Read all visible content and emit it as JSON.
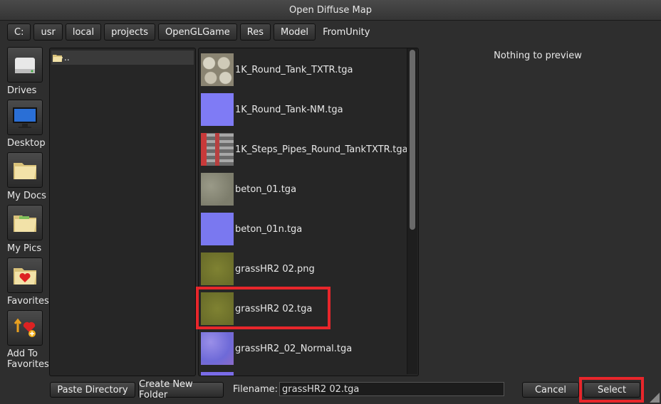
{
  "window": {
    "title": "Open Diffuse Map"
  },
  "breadcrumbs": [
    "C:",
    "usr",
    "local",
    "projects",
    "OpenGLGame",
    "Res",
    "Model",
    "FromUnity"
  ],
  "sidebar": {
    "items": [
      {
        "label": "Drives",
        "icon": "drive-icon"
      },
      {
        "label": "Desktop",
        "icon": "monitor-icon"
      },
      {
        "label": "My Docs",
        "icon": "folder-icon"
      },
      {
        "label": "My Pics",
        "icon": "picture-folder-icon"
      },
      {
        "label": "Favorites",
        "icon": "heart-folder-icon"
      },
      {
        "label": "Add To\nFavorites",
        "icon": "add-favorite-icon"
      }
    ]
  },
  "directories": {
    "items": [
      {
        "label": ".."
      }
    ]
  },
  "files": {
    "items": [
      {
        "name": "1K_Round_Tank_TXTR.tga",
        "thumb": "tank"
      },
      {
        "name": "1K_Round_Tank-NM.tga",
        "thumb": "normal"
      },
      {
        "name": "1K_Steps_Pipes_Round_TankTXTR.tga",
        "thumb": "pipes"
      },
      {
        "name": "beton_01.tga",
        "thumb": "concrete"
      },
      {
        "name": "beton_01n.tga",
        "thumb": "normal"
      },
      {
        "name": "grassHR2 02.png",
        "thumb": "grass"
      },
      {
        "name": "grassHR2 02.tga",
        "thumb": "grass"
      },
      {
        "name": "grassHR2_02_Normal.tga",
        "thumb": "grassnormal"
      }
    ],
    "selected_index": 6
  },
  "preview": {
    "text": "Nothing to preview"
  },
  "footer": {
    "paste_label": "Paste Directory",
    "create_folder_label": "Create New Folder",
    "filename_label": "Filename:",
    "filename_value": "grassHR2 02.tga",
    "cancel_label": "Cancel",
    "select_label": "Select"
  },
  "colors": {
    "highlight": "#e8262b",
    "background": "#2e2e2e"
  }
}
